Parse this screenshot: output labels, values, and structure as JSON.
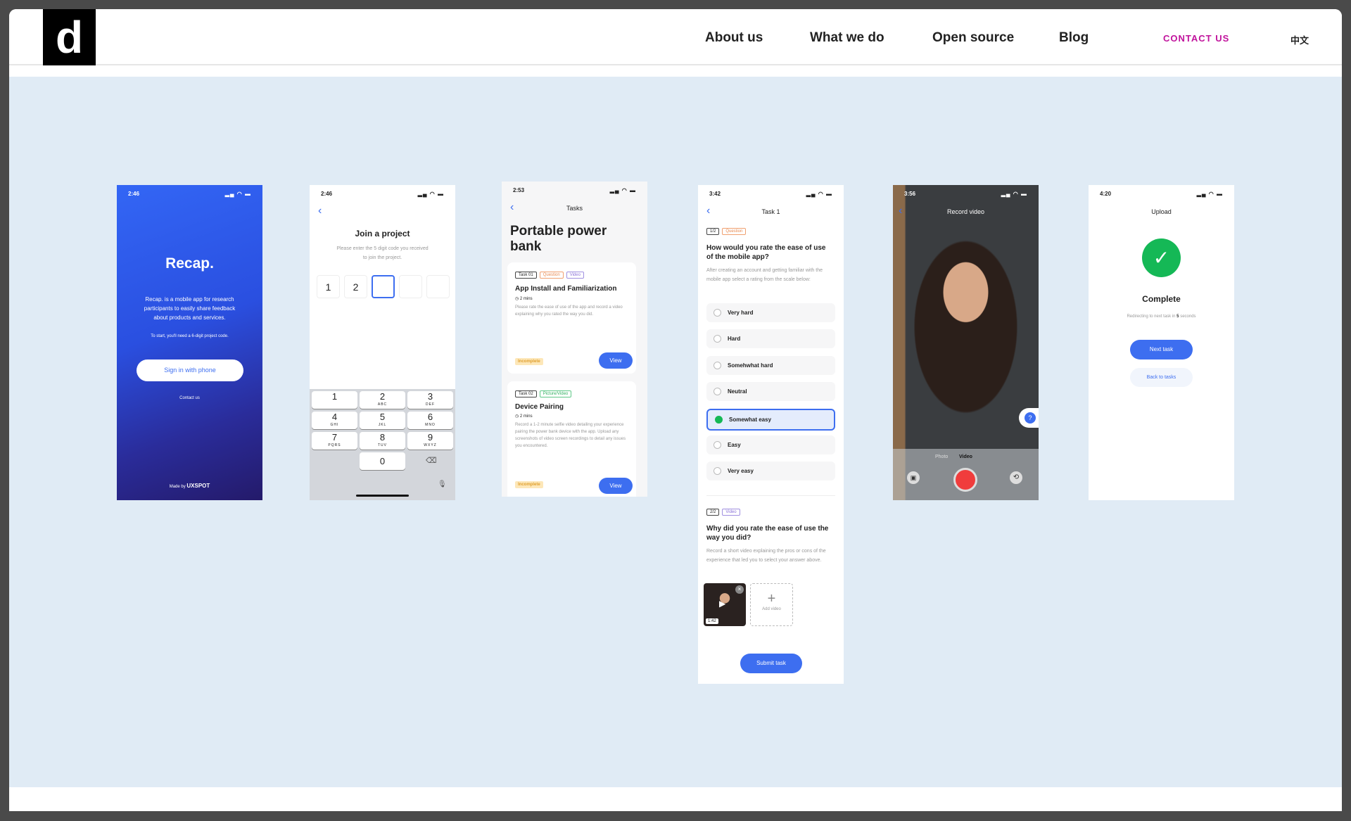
{
  "nav": {
    "items": [
      "About us",
      "What we do",
      "Open source",
      "Blog"
    ],
    "contact": "CONTACT US",
    "lang": "中文",
    "logo_letter": "d"
  },
  "colors": {
    "accent": "#3d6ef0",
    "contact": "#c1139c",
    "success": "#15b856",
    "hero_bg": "#e0ebf5"
  },
  "s1": {
    "time": "2:46",
    "title": "Recap.",
    "desc": "Recap. is a mobile app for research participants to easily share feedback about products and services.",
    "note": "To start, you'll need a 6-digit project code.",
    "button": "Sign in with phone",
    "contact": "Contact us",
    "made_by": "Made by",
    "brand": "UXSPOT"
  },
  "s2": {
    "time": "2:46",
    "title": "Join a project",
    "subtitle": "Please enter the 5 digit code you received to join the project.",
    "code": [
      "1",
      "2",
      "",
      "",
      ""
    ],
    "keys": [
      [
        "1",
        ""
      ],
      [
        "2",
        "ABC"
      ],
      [
        "3",
        "DEF"
      ],
      [
        "4",
        "GHI"
      ],
      [
        "5",
        "JKL"
      ],
      [
        "6",
        "MNO"
      ],
      [
        "7",
        "PQRS"
      ],
      [
        "8",
        "TUV"
      ],
      [
        "9",
        "WXYZ"
      ]
    ],
    "zero": "0"
  },
  "s3": {
    "time": "2:53",
    "header": "Tasks",
    "title": "Portable power bank",
    "cards": [
      {
        "tags": [
          "Task 01",
          "Question",
          "Video"
        ],
        "title": "App Install and Familiarization",
        "duration": "2 mins",
        "desc": "Please rate the ease of use of the app and record a video explaining why you rated the way you did.",
        "status": "Incomplete",
        "button": "View"
      },
      {
        "tags": [
          "Task 02",
          "Picture/Video"
        ],
        "title": "Device Pairing",
        "duration": "2 mins",
        "desc": "Record a 1-2 minute selfie video detailing your experience pairing the power bank device with the app. Upload any screenshots of video screen recordings to detail any issues you encountered.",
        "status": "Incomplete",
        "button": "View"
      }
    ]
  },
  "s4": {
    "time": "3:42",
    "header": "Task 1",
    "q1": {
      "step": "1/2",
      "type": "Question",
      "title": "How would you rate the ease of use of the mobile app?",
      "desc": "After creating an account and getting familiar with the mobile app select a rating from the scale below:",
      "options": [
        "Very hard",
        "Hard",
        "Somehwhat hard",
        "Neutral",
        "Somewhat easy",
        "Easy",
        "Very easy"
      ],
      "selected": "Somewhat easy"
    },
    "q2": {
      "step": "2/2",
      "type": "Video",
      "title": "Why did you rate the ease of use the way you did?",
      "desc": "Record a short video explaining the pros or cons of the experience that led you to select your answer above.",
      "video_duration": "1:42",
      "add_video": "Add video"
    },
    "submit": "Submit task"
  },
  "s5": {
    "time": "3:56",
    "header": "Record video",
    "modes": [
      "Photo",
      "Video"
    ],
    "selected_mode": "Video"
  },
  "s6": {
    "time": "4:20",
    "header": "Upload",
    "title": "Complete",
    "redirect_pre": "Redirecting to next task in",
    "redirect_num": "5",
    "redirect_post": "seconds",
    "next": "Next task",
    "back": "Back to tasks"
  }
}
